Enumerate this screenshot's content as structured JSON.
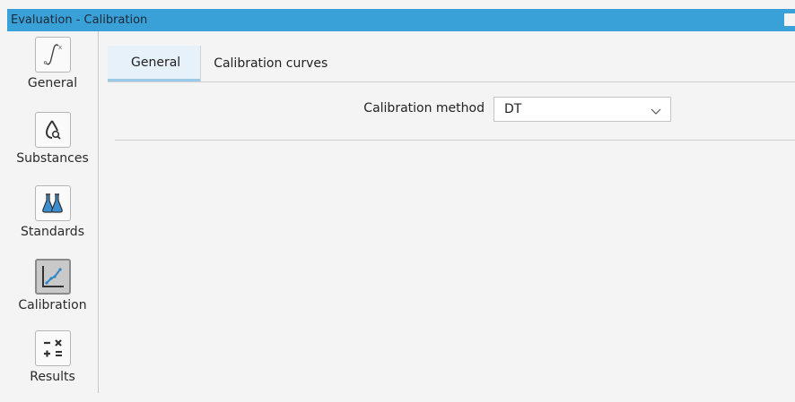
{
  "window": {
    "title": "Evaluation - Calibration"
  },
  "sidebar": {
    "items": [
      {
        "label": "General",
        "icon": "integral-icon",
        "active": false
      },
      {
        "label": "Substances",
        "icon": "drop-search-icon",
        "active": false
      },
      {
        "label": "Standards",
        "icon": "flasks-icon",
        "active": false
      },
      {
        "label": "Calibration",
        "icon": "calibration-curve-icon",
        "active": true
      },
      {
        "label": "Results",
        "icon": "calculator-icon",
        "active": false
      }
    ]
  },
  "tabs": [
    {
      "label": "General",
      "active": true
    },
    {
      "label": "Calibration curves",
      "active": false
    }
  ],
  "form": {
    "calibration_method_label": "Calibration method",
    "calibration_method_value": "DT"
  },
  "colors": {
    "titlebar": "#3aa0d8",
    "tab_active": "#e6f1fa",
    "accent": "#2f86c7"
  }
}
